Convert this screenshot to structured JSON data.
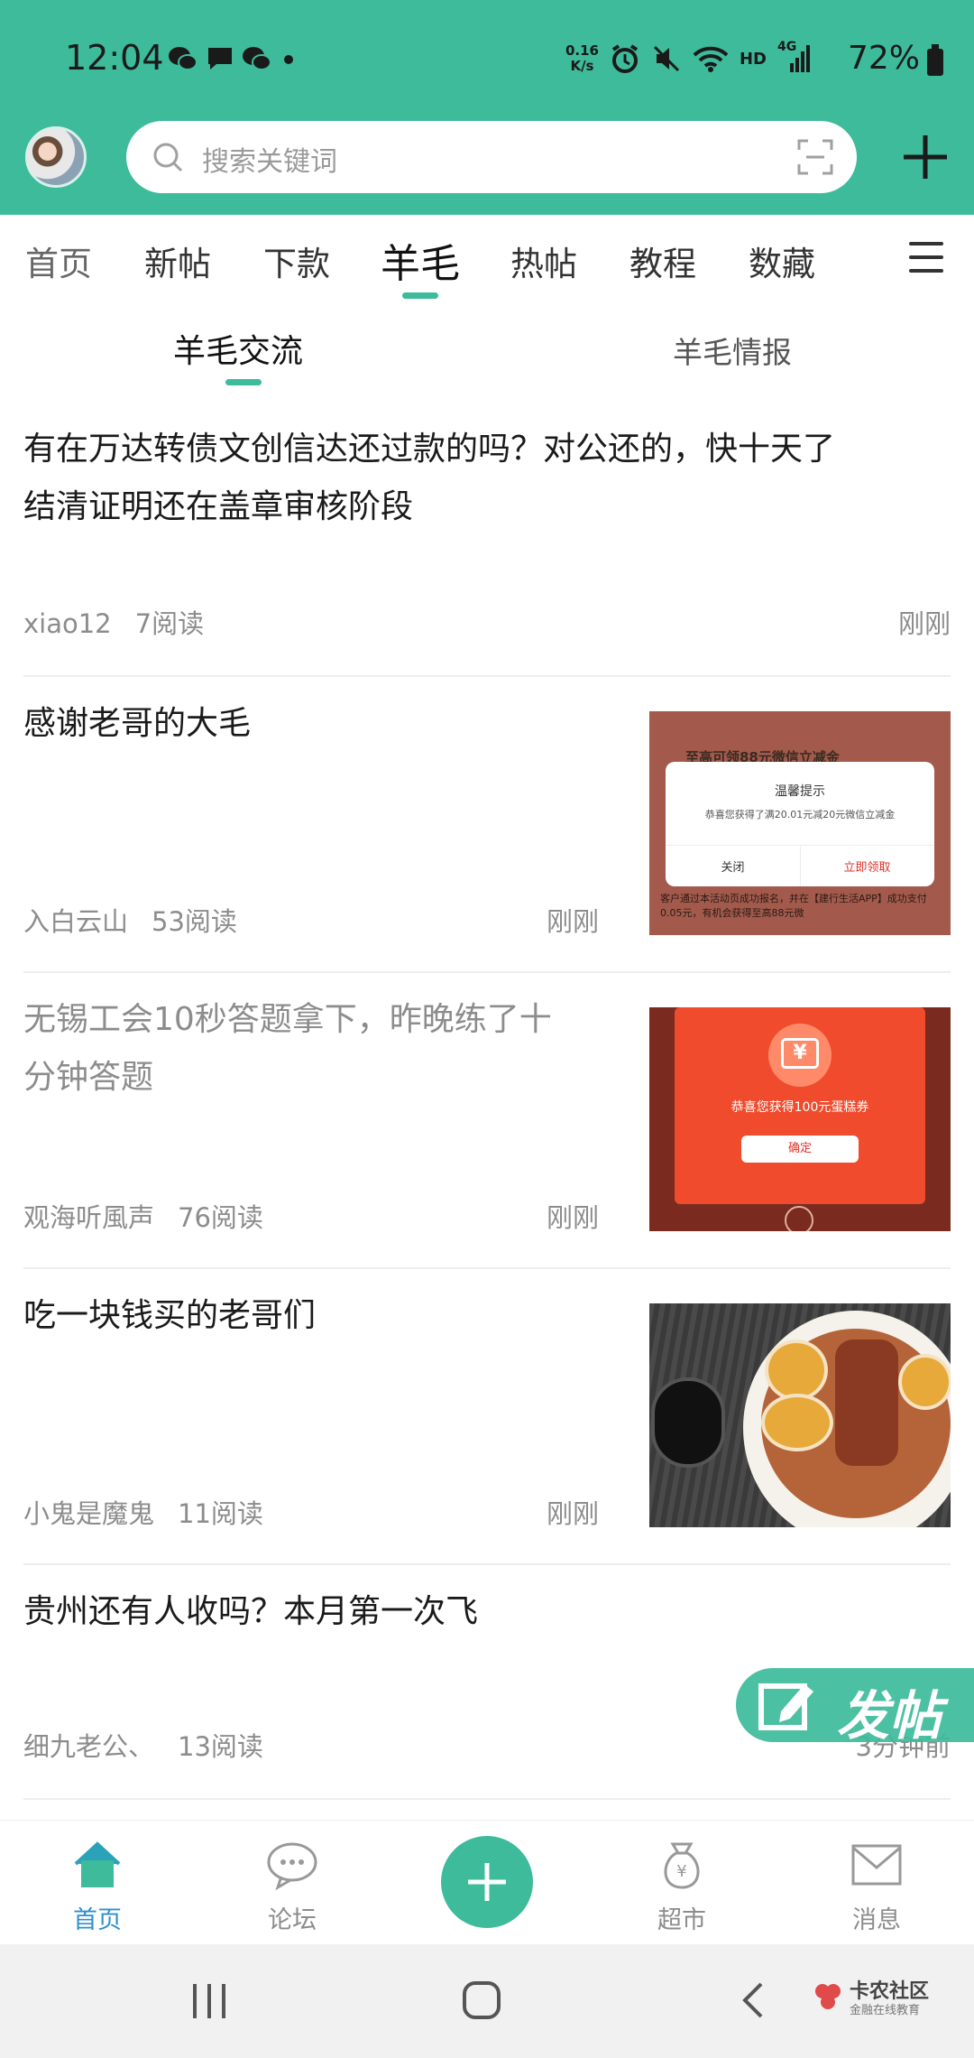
{
  "status_bar": {
    "time": "12:04",
    "net_speed_top": "0.16",
    "net_speed_bottom": "K/s",
    "network": "HD",
    "cell": "4G",
    "battery": "72%"
  },
  "header": {
    "search_placeholder": "搜索关键词"
  },
  "tabs": [
    {
      "label": "首页"
    },
    {
      "label": "新帖"
    },
    {
      "label": "下款"
    },
    {
      "label": "羊毛"
    },
    {
      "label": "热帖"
    },
    {
      "label": "教程"
    },
    {
      "label": "数藏"
    }
  ],
  "subtabs": [
    {
      "label": "羊毛交流"
    },
    {
      "label": "羊毛情报"
    }
  ],
  "posts": [
    {
      "title_line1": "有在万达转债文创信达还过款的吗？对公还的，快十天了",
      "title_line2": "结清证明还在盖章审核阶段",
      "author": "xiao12",
      "reads": "7阅读",
      "time": "刚刚"
    },
    {
      "title_line1": "感谢老哥的大毛",
      "author": "入白云山",
      "reads": "53阅读",
      "time": "刚刚",
      "thumb": {
        "header": "至高可领88元微信立减金",
        "dialog_title": "温馨提示",
        "dialog_text": "恭喜您获得了满20.01元减20元微信立减金",
        "btn_close": "关闭",
        "btn_claim": "立即领取",
        "footer": "客户通过本活动页成功报名，并在【建行生活APP】成功支付0.05元，有机会获得至高88元微"
      }
    },
    {
      "title_line1": "无锡工会10秒答题拿下，昨晚练了十",
      "title_line2": "分钟答题",
      "author": "观海听風声",
      "reads": "76阅读",
      "time": "刚刚",
      "thumb": {
        "coupon_text": "恭喜您获得100元蛋糕券",
        "confirm": "确定",
        "symbol": "¥"
      }
    },
    {
      "title_line1": "吃一块钱买的老哥们",
      "author": "小鬼是魔鬼",
      "reads": "11阅读",
      "time": "刚刚"
    },
    {
      "title_line1": "贵州还有人收吗？本月第一次飞",
      "author": "细九老公、",
      "reads": "13阅读",
      "time": "3分钟前"
    }
  ],
  "fab_post_label": "发帖",
  "bottom_nav": [
    {
      "label": "首页"
    },
    {
      "label": "论坛"
    },
    {
      "label": "超市"
    },
    {
      "label": "消息"
    }
  ],
  "watermark": {
    "title": "卡农社区",
    "subtitle": "金融在线教育"
  },
  "colors": {
    "brand": "#3dbb9b",
    "active_nav": "#2f8fcf"
  }
}
